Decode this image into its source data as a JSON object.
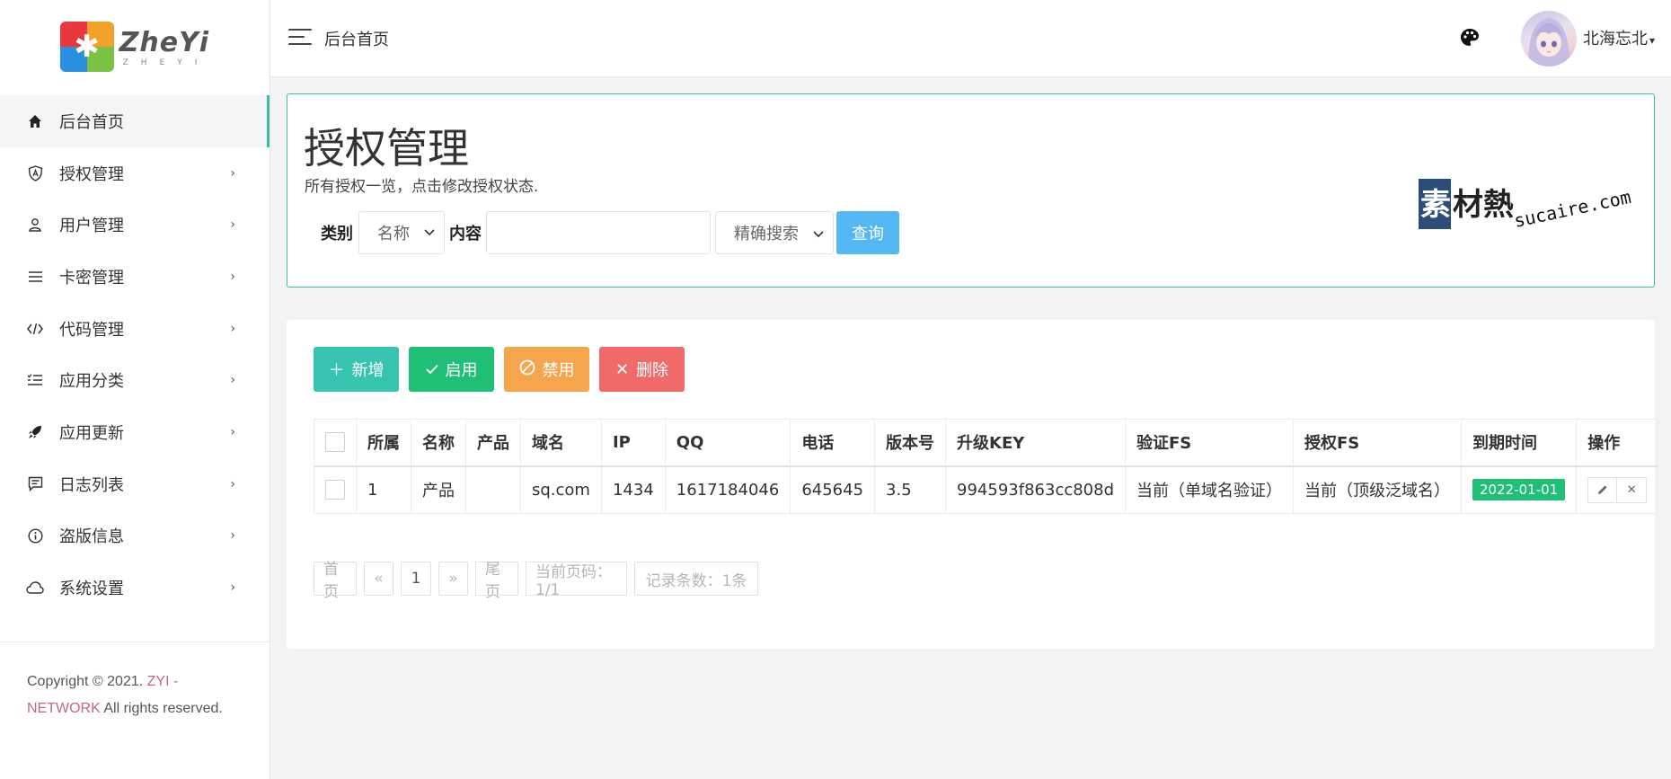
{
  "logo": {
    "text": "ZheYi",
    "sub": "ZHEYI"
  },
  "sidebar": {
    "items": [
      {
        "label": "后台首页",
        "icon": "home-icon",
        "active": true
      },
      {
        "label": "授权管理",
        "icon": "shield-icon"
      },
      {
        "label": "用户管理",
        "icon": "user-icon"
      },
      {
        "label": "卡密管理",
        "icon": "menu-lines-icon"
      },
      {
        "label": "代码管理",
        "icon": "code-icon"
      },
      {
        "label": "应用分类",
        "icon": "category-list-icon"
      },
      {
        "label": "应用更新",
        "icon": "rocket-icon"
      },
      {
        "label": "日志列表",
        "icon": "message-icon"
      },
      {
        "label": "盗版信息",
        "icon": "info-icon"
      },
      {
        "label": "系统设置",
        "icon": "cloud-icon"
      }
    ],
    "copyright_prefix": "Copyright © 2021.",
    "copyright_brand": "ZYI - NETWORK",
    "copyright_suffix": "All rights reserved."
  },
  "topbar": {
    "breadcrumb": "后台首页",
    "username": "北海忘北"
  },
  "header": {
    "title": "授权管理",
    "description": "所有授权一览，点击修改授权状态.",
    "search": {
      "type_label": "类别",
      "type_value": "名称",
      "content_label": "内容",
      "content_value": "",
      "mode_value": "精确搜索",
      "query_button": "查询"
    },
    "watermark": {
      "cn": "素材熱",
      "en": "sucaire.com"
    }
  },
  "toolbar": {
    "add": "新增",
    "enable": "启用",
    "disable": "禁用",
    "delete": "删除"
  },
  "table": {
    "columns": [
      "所属",
      "名称",
      "产品",
      "域名",
      "IP",
      "QQ",
      "电话",
      "版本号",
      "升级KEY",
      "验证FS",
      "授权FS",
      "到期时间",
      "操作"
    ],
    "rows": [
      {
        "owner": "1",
        "name": "产品",
        "product": "",
        "domain": "sq.com",
        "ip": "1434",
        "qq": "1617184046",
        "phone": "645645",
        "version": "3.5",
        "upgrade_key": "994593f863cc808d",
        "verify_fs": "当前（单域名验证）",
        "auth_fs": "当前（顶级泛域名）",
        "expire": "2022-01-01"
      }
    ]
  },
  "pager": {
    "first": "首页",
    "prev": "«",
    "page": "1",
    "next": "»",
    "last": "尾页",
    "current_info": "当前页码：1/1",
    "count_info": "记录条数：1条"
  },
  "colors": {
    "accent": "#36bfa8",
    "add": "#36c3b0",
    "enable": "#1fbf75",
    "disable": "#f5a64d",
    "delete": "#f16a6a",
    "query": "#53b7f4"
  }
}
